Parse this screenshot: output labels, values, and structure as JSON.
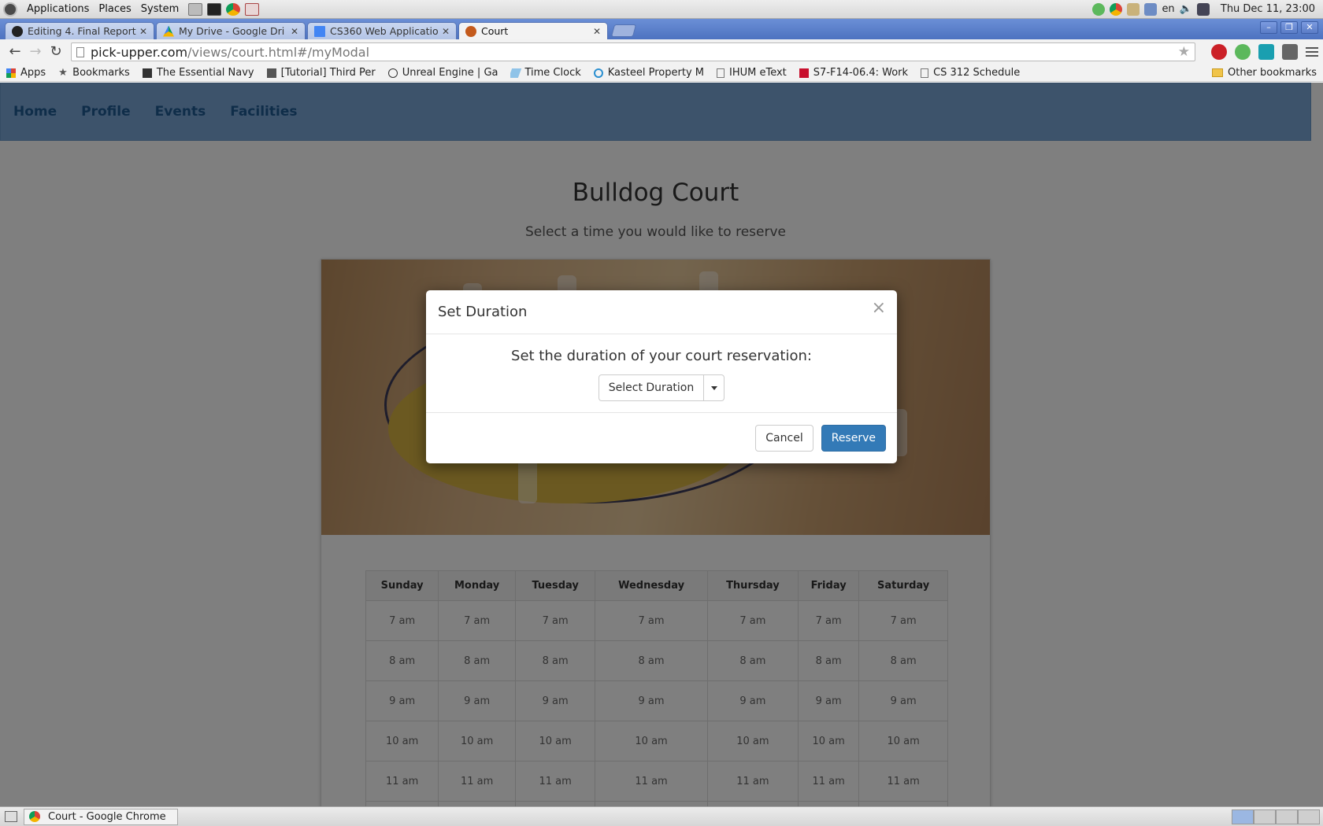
{
  "gnome_panel": {
    "menus": [
      "Applications",
      "Places",
      "System"
    ],
    "lang": "en",
    "clock": "Thu Dec 11, 23:00"
  },
  "tabs": [
    {
      "title": "Editing 4. Final Report",
      "favicon": "github-icon",
      "active": false
    },
    {
      "title": "My Drive - Google Dri",
      "favicon": "drive-icon",
      "active": false
    },
    {
      "title": "CS360 Web Applicatio",
      "favicon": "docs-icon",
      "active": false
    },
    {
      "title": "Court",
      "favicon": "basketball-icon",
      "active": true
    }
  ],
  "omnibox": {
    "host": "pick-upper.com",
    "path": "/views/court.html#/myModal"
  },
  "bookmarks": {
    "apps": "Apps",
    "bookmarks": "Bookmarks",
    "items": [
      "The Essential Navy",
      "[Tutorial] Third Per",
      "Unreal Engine | Ga",
      "Time Clock",
      "Kasteel Property M",
      "IHUM eText",
      "S7-F14-06.4: Work",
      "CS 312 Schedule"
    ],
    "other": "Other bookmarks"
  },
  "site_nav": [
    "Home",
    "Profile",
    "Events",
    "Facilities"
  ],
  "page": {
    "title": "Bulldog Court",
    "subtitle": "Select a time you would like to reserve"
  },
  "schedule": {
    "days": [
      "Sunday",
      "Monday",
      "Tuesday",
      "Wednesday",
      "Thursday",
      "Friday",
      "Saturday"
    ],
    "times": [
      "7 am",
      "8 am",
      "9 am",
      "10 am",
      "11 am"
    ]
  },
  "modal": {
    "title": "Set Duration",
    "close": "×",
    "prompt": "Set the duration of your court reservation:",
    "select_label": "Select Duration",
    "cancel": "Cancel",
    "reserve": "Reserve"
  },
  "taskbar": {
    "task": "Court - Google Chrome"
  },
  "colors": {
    "navbar": "#7aa7d6",
    "nav_link": "#1f5a93",
    "primary": "#337ab7",
    "tabstrip": "#4d72c0"
  }
}
